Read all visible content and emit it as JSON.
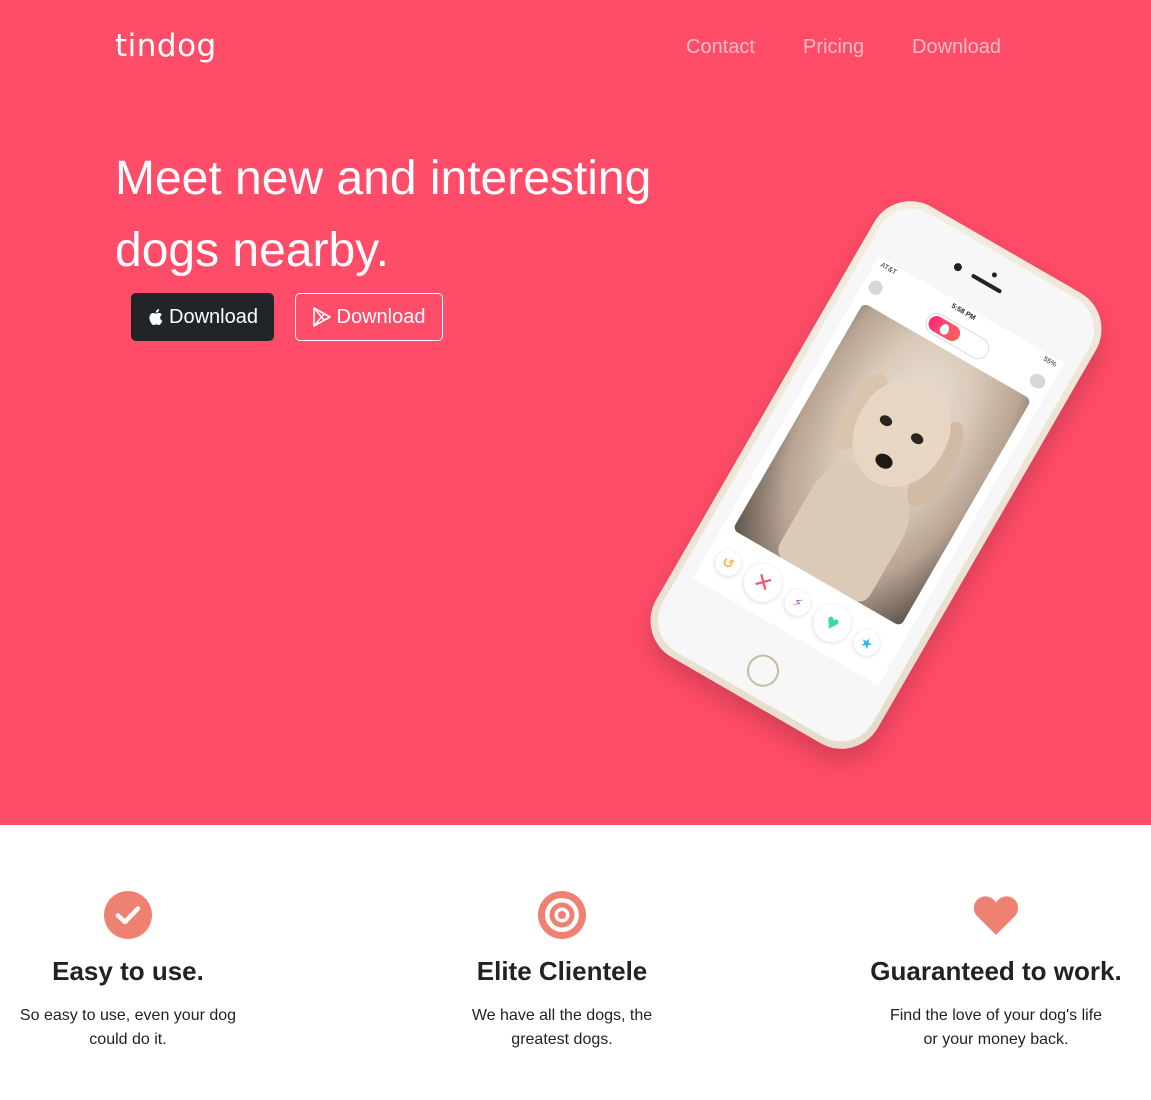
{
  "brand": {
    "name": "tindog"
  },
  "nav": {
    "items": [
      {
        "label": "Contact"
      },
      {
        "label": "Pricing"
      },
      {
        "label": "Download"
      }
    ]
  },
  "hero": {
    "headline": "Meet new and interesting dogs nearby.",
    "buttons": [
      {
        "label": "Download",
        "icon": "apple-icon"
      },
      {
        "label": "Download",
        "icon": "google-play-icon"
      }
    ]
  },
  "phone": {
    "carrier": "AT&T",
    "time": "5:58 PM",
    "battery": "55%"
  },
  "features": [
    {
      "icon": "check-circle-icon",
      "title": "Easy to use.",
      "text": "So easy to use, even your dog could do it."
    },
    {
      "icon": "bullseye-icon",
      "title": "Elite Clientele",
      "text": "We have all the dogs, the greatest dogs."
    },
    {
      "icon": "heart-icon",
      "title": "Guaranteed to work.",
      "text": "Find the love of your dog's life or your money back."
    }
  ],
  "colors": {
    "hero_bg": "#ff4c68",
    "feature_icon": "#ef8172",
    "dark_button": "#212529"
  }
}
